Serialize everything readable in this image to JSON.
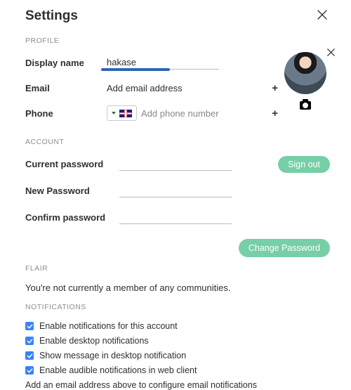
{
  "header": {
    "title": "Settings"
  },
  "sections": {
    "profile": "PROFILE",
    "account": "ACCOUNT",
    "flair": "FLAIR",
    "notifications": "NOTIFICATIONS"
  },
  "profile": {
    "display_name_label": "Display name",
    "display_name_value": "hakase",
    "email_label": "Email",
    "email_add_text": "Add email address",
    "phone_label": "Phone",
    "phone_placeholder": "Add phone number",
    "phone_country": "GB"
  },
  "account": {
    "current_password_label": "Current password",
    "new_password_label": "New Password",
    "confirm_password_label": "Confirm password",
    "sign_out_label": "Sign out",
    "change_password_label": "Change Password"
  },
  "flair": {
    "text": "You're not currently a member of any communities."
  },
  "notifications": {
    "items": [
      "Enable notifications for this account",
      "Enable desktop notifications",
      "Show message in desktop notification",
      "Enable audible notifications in web client"
    ],
    "footer": "Add an email address above to configure email notifications"
  },
  "colors": {
    "accent_button": "#76cfa6",
    "checkbox": "#3b82f6",
    "name_underline": "#2e64b5"
  }
}
